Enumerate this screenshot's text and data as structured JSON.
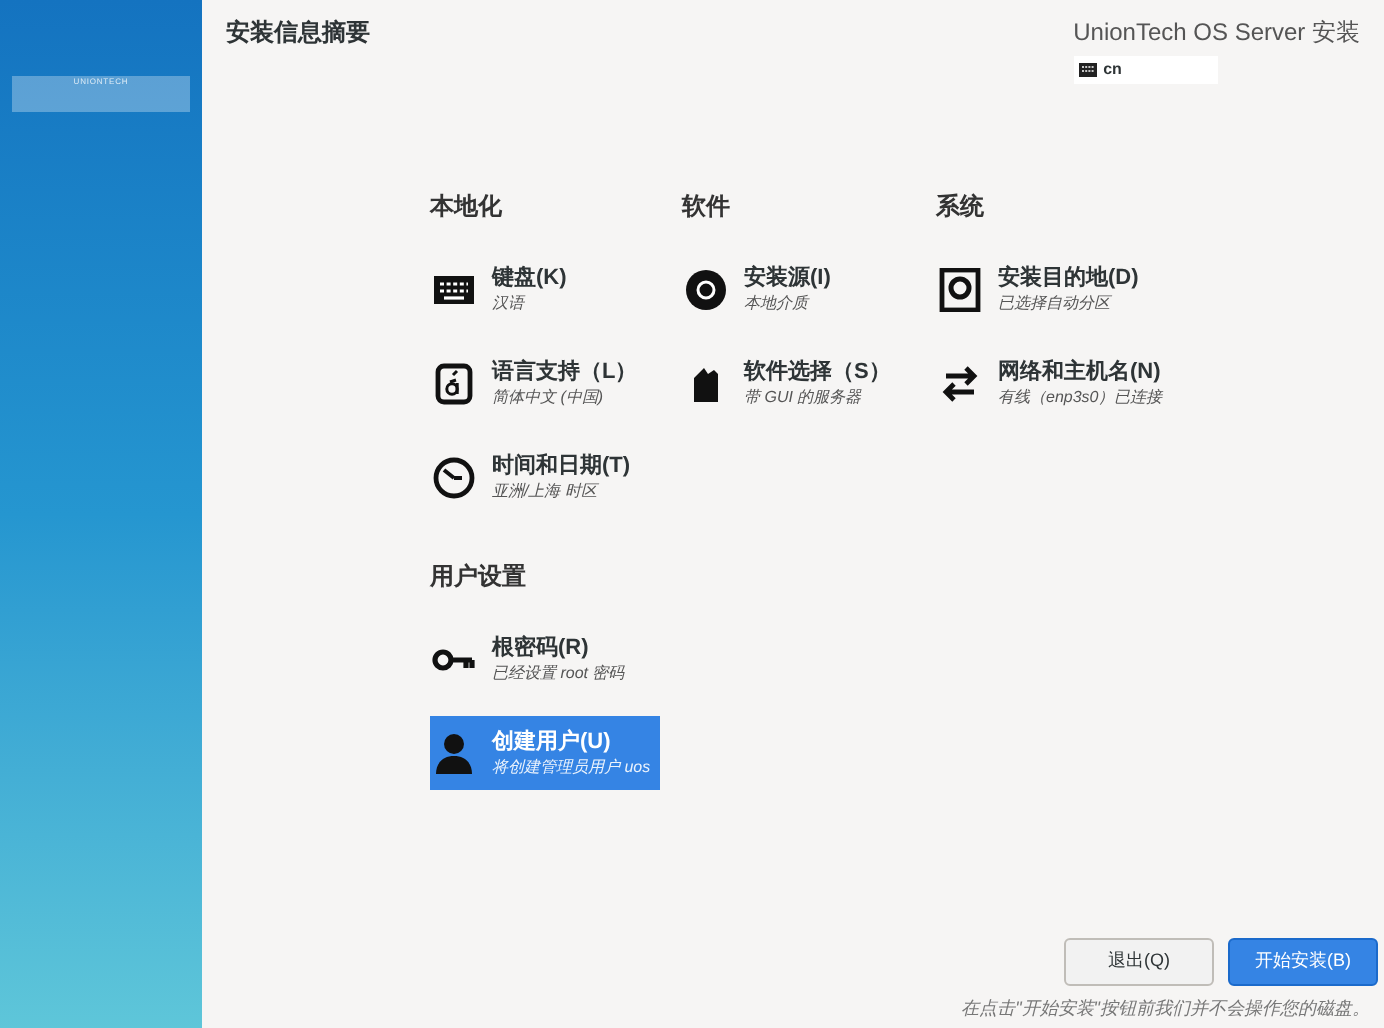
{
  "sidebar": {
    "logo_text": "UNIONTECH"
  },
  "header": {
    "title": "安装信息摘要",
    "product": "UnionTech OS Server 安装",
    "keyboard_layout": "cn"
  },
  "sections": [
    {
      "title": "本地化",
      "items": [
        {
          "title": "键盘(K)",
          "status": "汉语",
          "selected": false
        },
        {
          "title": "语言支持（L）",
          "status": "简体中文 (中国)",
          "selected": false
        },
        {
          "title": "时间和日期(T)",
          "status": "亚洲/上海 时区",
          "selected": false
        }
      ]
    },
    {
      "title": "软件",
      "items": [
        {
          "title": "安装源(I)",
          "status": "本地介质",
          "selected": false
        },
        {
          "title": "软件选择（S）",
          "status": "带 GUI 的服务器",
          "selected": false
        }
      ]
    },
    {
      "title": "系统",
      "items": [
        {
          "title": "安装目的地(D)",
          "status": "已选择自动分区",
          "selected": false
        },
        {
          "title": "网络和主机名(N)",
          "status": "有线（enp3s0）已连接",
          "selected": false
        }
      ]
    },
    {
      "title": "用户设置",
      "items": [
        {
          "title": "根密码(R)",
          "status": "已经设置 root 密码",
          "selected": false
        },
        {
          "title": "创建用户(U)",
          "status": "将创建管理员用户 uos",
          "selected": true
        }
      ]
    }
  ],
  "buttons": [
    {
      "label": "退出(Q)",
      "kind": "secondary"
    },
    {
      "label": "开始安装(B)",
      "kind": "primary"
    }
  ],
  "footnote": "在点击\"开始安装\"按钮前我们并不会操作您的磁盘。"
}
